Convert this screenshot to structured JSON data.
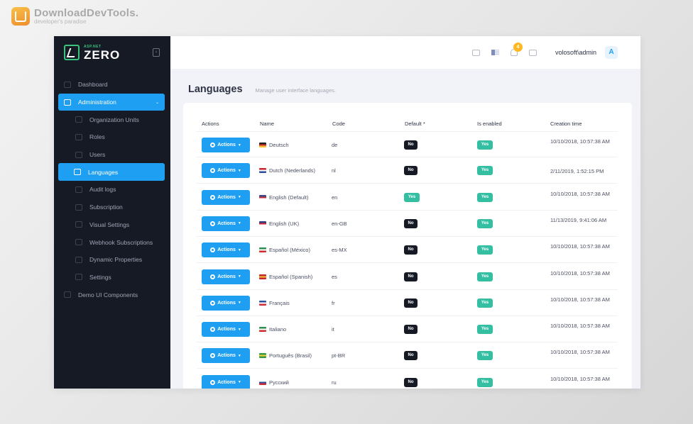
{
  "watermark": {
    "title": "DownloadDevTools.",
    "subtitle": "developer's paradise"
  },
  "brand": {
    "small": "ASP.NET",
    "big": "ZERO"
  },
  "sidebar": {
    "items": [
      {
        "label": "Dashboard",
        "level": 0,
        "state": "normal"
      },
      {
        "label": "Administration",
        "level": 0,
        "state": "open"
      },
      {
        "label": "Organization Units",
        "level": 1,
        "state": "normal"
      },
      {
        "label": "Roles",
        "level": 1,
        "state": "normal"
      },
      {
        "label": "Users",
        "level": 1,
        "state": "normal"
      },
      {
        "label": "Languages",
        "level": 1,
        "state": "active"
      },
      {
        "label": "Audit logs",
        "level": 1,
        "state": "normal"
      },
      {
        "label": "Subscription",
        "level": 1,
        "state": "normal"
      },
      {
        "label": "Visual Settings",
        "level": 1,
        "state": "normal"
      },
      {
        "label": "Webhook Subscriptions",
        "level": 1,
        "state": "normal"
      },
      {
        "label": "Dynamic Properties",
        "level": 1,
        "state": "normal"
      },
      {
        "label": "Settings",
        "level": 1,
        "state": "normal"
      },
      {
        "label": "Demo UI Components",
        "level": 0,
        "state": "normal"
      }
    ]
  },
  "topbar": {
    "notification_count": "4",
    "user": "volosoft\\admin",
    "avatar_letter": "A"
  },
  "page": {
    "title": "Languages",
    "description": "Manage user interface languages."
  },
  "table": {
    "headers": {
      "actions": "Actions",
      "name": "Name",
      "code": "Code",
      "default": "Default *",
      "enabled": "Is enabled",
      "created": "Creation time"
    },
    "action_label": "Actions",
    "yes_label": "Yes",
    "no_label": "No",
    "rows": [
      {
        "name": "Deutsch",
        "code": "de",
        "default": "No",
        "enabled": "Yes",
        "created": "10/10/2018, 10:57:38 AM",
        "flag": [
          "#222222",
          "#d62b2b",
          "#f2c230"
        ]
      },
      {
        "name": "Dutch (Nederlands)",
        "code": "nl",
        "default": "No",
        "enabled": "Yes",
        "created": "2/11/2019, 1:52:15 PM",
        "flag": [
          "#c8262c",
          "#ffffff",
          "#2b4fa0"
        ]
      },
      {
        "name": "English (Default)",
        "code": "en",
        "default": "Yes",
        "enabled": "Yes",
        "created": "10/10/2018, 10:57:38 AM",
        "flag": [
          "#3b4a8c",
          "#c62f3b",
          "#ffffff"
        ]
      },
      {
        "name": "English (UK)",
        "code": "en-GB",
        "default": "No",
        "enabled": "Yes",
        "created": "11/13/2019, 9:41:06 AM",
        "flag": [
          "#2a3d86",
          "#d42a35",
          "#ffffff"
        ]
      },
      {
        "name": "Español (México)",
        "code": "es-MX",
        "default": "No",
        "enabled": "Yes",
        "created": "10/10/2018, 10:57:38 AM",
        "flag": [
          "#2f8f4e",
          "#ffffff",
          "#cf2b2b"
        ]
      },
      {
        "name": "Español (Spanish)",
        "code": "es",
        "default": "No",
        "enabled": "Yes",
        "created": "10/10/2018, 10:57:38 AM",
        "flag": [
          "#c8262c",
          "#f4c430",
          "#c8262c"
        ]
      },
      {
        "name": "Français",
        "code": "fr",
        "default": "No",
        "enabled": "Yes",
        "created": "10/10/2018, 10:57:38 AM",
        "flag": [
          "#2b4fa0",
          "#ffffff",
          "#d42a35"
        ]
      },
      {
        "name": "Italiano",
        "code": "it",
        "default": "No",
        "enabled": "Yes",
        "created": "10/10/2018, 10:57:38 AM",
        "flag": [
          "#2f8f4e",
          "#ffffff",
          "#cf2b2b"
        ]
      },
      {
        "name": "Português (Brasil)",
        "code": "pt-BR",
        "default": "No",
        "enabled": "Yes",
        "created": "10/10/2018, 10:57:38 AM",
        "flag": [
          "#2f9a43",
          "#f4d23a",
          "#2f9a43"
        ]
      },
      {
        "name": "Русский",
        "code": "ru",
        "default": "No",
        "enabled": "Yes",
        "created": "10/10/2018, 10:57:38 AM",
        "flag": [
          "#ffffff",
          "#2b4fa0",
          "#d42a35"
        ]
      }
    ]
  },
  "colors": {
    "accent": "#1e9ff2",
    "sidebar": "#161a25",
    "success": "#34bfa3",
    "badge": "#ffb822"
  }
}
